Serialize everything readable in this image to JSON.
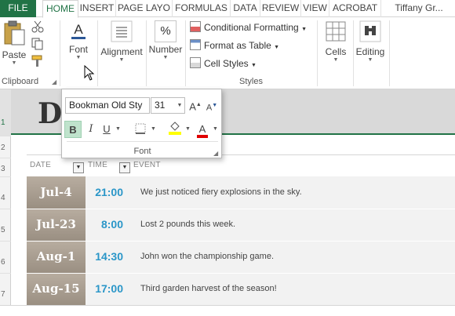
{
  "tabs": [
    {
      "label": "FILE"
    },
    {
      "label": "HOME"
    },
    {
      "label": "INSERT"
    },
    {
      "label": "PAGE LAYO"
    },
    {
      "label": "FORMULAS"
    },
    {
      "label": "DATA"
    },
    {
      "label": "REVIEW"
    },
    {
      "label": "VIEW"
    },
    {
      "label": "ACROBAT"
    },
    {
      "label": "Tiffany Gr..."
    }
  ],
  "ribbon": {
    "clipboard": {
      "paste": "Paste",
      "group": "Clipboard"
    },
    "font": {
      "label": "Font"
    },
    "alignment": {
      "label": "Alignment"
    },
    "number": {
      "label": "Number",
      "symbol": "%"
    },
    "styles": {
      "conditional": "Conditional Formatting",
      "format_table": "Format as Table",
      "cell_styles": "Cell Styles",
      "group": "Styles"
    },
    "cells": {
      "label": "Cells"
    },
    "editing": {
      "label": "Editing"
    }
  },
  "font_popup": {
    "font_name": "Bookman Old Sty",
    "font_size": "31",
    "grow": "A",
    "shrink": "A",
    "bold": "B",
    "italic": "I",
    "underline": "U",
    "font_color_glyph": "A",
    "group_label": "Font",
    "highlight_color": "#ffff00",
    "font_color": "#e00000"
  },
  "sheet": {
    "title_visible": "D",
    "row_numbers": [
      "1",
      "2",
      "3",
      "4",
      "5",
      "6",
      "7"
    ],
    "headers": {
      "date": "DATE",
      "time": "TIME",
      "event": "EVENT"
    },
    "rows": [
      {
        "date": "Jul-4",
        "time": "21:00",
        "event": "We just noticed fiery explosions in the sky."
      },
      {
        "date": "Jul-23",
        "time": "8:00",
        "event": "Lost 2 pounds this week."
      },
      {
        "date": "Aug-1",
        "time": "14:30",
        "event": "John won the championship game."
      },
      {
        "date": "Aug-15",
        "time": "17:00",
        "event": "Third garden harvest of the season!"
      }
    ]
  },
  "colors": {
    "excel_green": "#217346",
    "time_blue": "#2a96c8",
    "date_taupe": "#a99e91"
  }
}
